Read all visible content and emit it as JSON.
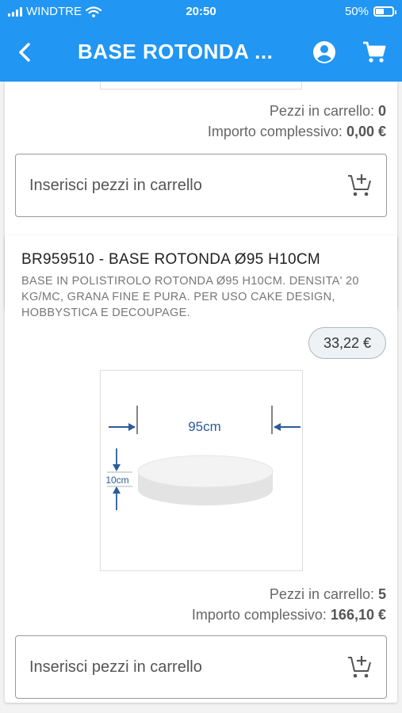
{
  "status_bar": {
    "carrier": "WINDTRE",
    "time": "20:50",
    "battery_percent": "50%",
    "battery_level": 0.5
  },
  "header": {
    "title": "BASE ROTONDA ...",
    "back_icon": "chevron-left-icon",
    "account_icon": "account-circle-icon",
    "cart_icon": "shopping-cart-icon",
    "background_color": "#2196f3"
  },
  "products": [
    {
      "cart_pieces_label": "Pezzi in carrello:",
      "cart_pieces_value": "0",
      "total_label": "Importo complessivo:",
      "total_value": "0,00 €",
      "input_placeholder": "Inserisci pezzi in carrello",
      "add_icon": "add-shopping-cart-icon"
    },
    {
      "title": "BR959510 - BASE ROTONDA Ø95 H10CM",
      "description": "BASE IN POLISTIROLO ROTONDA Ø95 H10CM. DENSITA' 20 KG/MC, GRANA FINE E PURA. PER USO CAKE DESIGN, HOBBYSTICA E DECOUPAGE.",
      "price": "33,22 €",
      "image_width_label": "95cm",
      "image_height_label": "10cm",
      "cart_pieces_label": "Pezzi in carrello:",
      "cart_pieces_value": "5",
      "total_label": "Importo complessivo:",
      "total_value": "166,10 €",
      "input_placeholder": "Inserisci pezzi in carrello",
      "add_icon": "add-shopping-cart-icon"
    }
  ]
}
